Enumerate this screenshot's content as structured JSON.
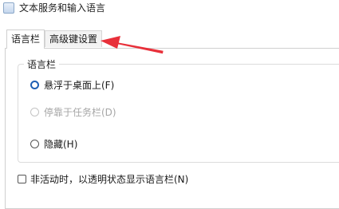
{
  "window": {
    "title": "文本服务和输入语言",
    "icon": "keyboard-app-icon"
  },
  "tabs": [
    {
      "label": "语言栏",
      "active": true
    },
    {
      "label": "高级键设置",
      "active": false
    }
  ],
  "language_bar": {
    "group_label": "语言栏",
    "options": [
      {
        "label": "悬浮于桌面上(F)",
        "checked": true,
        "enabled": true
      },
      {
        "label": "停靠于任务栏(D)",
        "checked": false,
        "enabled": false
      },
      {
        "label": "隐藏(H)",
        "checked": false,
        "enabled": true
      }
    ],
    "transparent_checkbox": {
      "label": "非活动时，以透明状态显示语言栏(N)",
      "checked": false
    }
  },
  "annotation": {
    "type": "arrow",
    "color": "#e8303a",
    "points_to": "高级键设置"
  }
}
